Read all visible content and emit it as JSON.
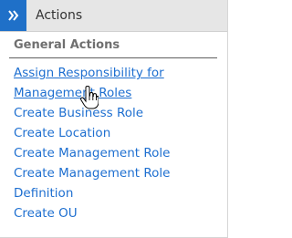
{
  "header": {
    "title": "Actions",
    "toggle_icon": "double-chevron-right-icon"
  },
  "section": {
    "title": "General Actions"
  },
  "actions": [
    {
      "label": "Assign Responsibility for Management Roles"
    },
    {
      "label": "Create Business Role"
    },
    {
      "label": "Create Location"
    },
    {
      "label": "Create Management Role"
    },
    {
      "label": "Create Management Role Definition"
    },
    {
      "label": "Create OU"
    }
  ],
  "colors": {
    "toggle_bg": "#1f70c8",
    "header_bg": "#e6e6e6",
    "link": "#1e6fd0",
    "section_title": "#6f6f6f"
  },
  "cursor": {
    "icon": "hand-pointer-icon"
  }
}
